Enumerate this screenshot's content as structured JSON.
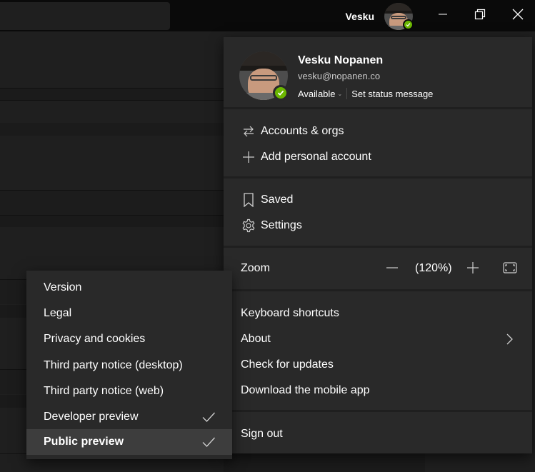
{
  "titlebar": {
    "username": "Vesku",
    "icons": [
      "minimize-icon",
      "restore-icon",
      "close-icon"
    ]
  },
  "profile": {
    "name": "Vesku Nopanen",
    "email": "vesku@nopanen.co",
    "status": "Available",
    "status_message_label": "Set status message",
    "presence_color": "#6bb700"
  },
  "menu": {
    "accounts": {
      "label": "Accounts & orgs",
      "icon": "switch-arrows-icon"
    },
    "add_account": {
      "label": "Add personal account",
      "icon": "plus-icon"
    },
    "saved": {
      "label": "Saved",
      "icon": "bookmark-icon"
    },
    "settings": {
      "label": "Settings",
      "icon": "gear-icon"
    },
    "zoom": {
      "label": "Zoom",
      "value": "(120%)"
    },
    "keyboard_shortcuts": "Keyboard shortcuts",
    "about": "About",
    "check_updates": "Check for updates",
    "download_mobile": "Download the mobile app",
    "sign_out": "Sign out"
  },
  "about_submenu": {
    "items": [
      {
        "label": "Version",
        "checked": false,
        "active": false
      },
      {
        "label": "Legal",
        "checked": false,
        "active": false
      },
      {
        "label": "Privacy and cookies",
        "checked": false,
        "active": false
      },
      {
        "label": "Third party notice (desktop)",
        "checked": false,
        "active": false
      },
      {
        "label": "Third party notice (web)",
        "checked": false,
        "active": false
      },
      {
        "label": "Developer preview",
        "checked": true,
        "active": false
      },
      {
        "label": "Public preview",
        "checked": true,
        "active": true
      }
    ]
  },
  "colors": {
    "titlebar": "#0a0a0a",
    "menu_bg": "#292929",
    "app_bg": "#1f1f1f",
    "hover_bg": "#3d3d3d",
    "presence_available": "#6bb700"
  }
}
